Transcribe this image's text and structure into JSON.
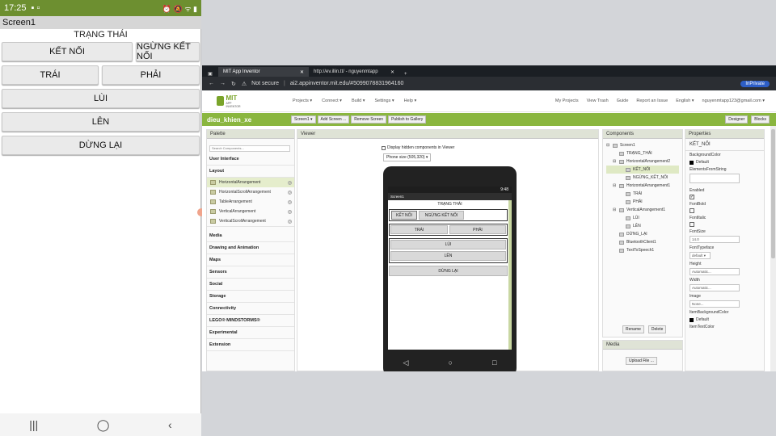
{
  "phone": {
    "status": {
      "time": "17:25",
      "right": "⏰ 🔕 ᯤ ▮"
    },
    "title": "Screen1",
    "label": "TRẠNG THÁI",
    "buttons": {
      "connect": "KẾT NỐI",
      "disconnect": "NGỪNG KẾT NỐI",
      "left": "TRÁI",
      "right": "PHẢI",
      "back": "LÙI",
      "forward": "LÊN",
      "stop": "DỪNG LẠI"
    },
    "nav": {
      "recents": "|||",
      "home": "◯",
      "back": "‹"
    }
  },
  "browser": {
    "tabs": [
      {
        "label": "MIT App Inventor",
        "icon": "app-inventor-icon"
      },
      {
        "label": "http://ev.illin.tt/ - nguyenmtapp"
      }
    ],
    "url_prefix": "Not secure",
    "url": "ai2.appinventor.mit.edu/#5099078831964160",
    "private_label": "InPrivate"
  },
  "appinventor": {
    "logo": {
      "mit": "MIT",
      "sub": "APP INVENTOR"
    },
    "menu": [
      "Projects ▾",
      "Connect ▾",
      "Build ▾",
      "Settings ▾",
      "Help ▾"
    ],
    "right_menu": [
      "My Projects",
      "View Trash",
      "Guide",
      "Report an Issue",
      "English ▾",
      "nguyenmtapp123@gmail.com ▾"
    ],
    "project_name": "dieu_khien_xe",
    "project_buttons": [
      "Screen1 ▾",
      "Add Screen ...",
      "Remove Screen",
      "Publish to Gallery"
    ],
    "mode_buttons": [
      "Designer",
      "Blocks"
    ],
    "palette": {
      "title": "Palette",
      "search_placeholder": "Search Components...",
      "categories_top": [
        "User Interface",
        "Layout"
      ],
      "layout_items": [
        "HorizontalArrangement",
        "HorizontalScrollArrangement",
        "TableArrangement",
        "VerticalArrangement",
        "VerticalScrollArrangement"
      ],
      "categories_bottom": [
        "Media",
        "Drawing and Animation",
        "Maps",
        "Sensors",
        "Social",
        "Storage",
        "Connectivity",
        "LEGO® MINDSTORMS®",
        "Experimental",
        "Extension"
      ]
    },
    "viewer": {
      "title": "Viewer",
      "checkbox_label": "Display hidden components in Viewer",
      "size_select": "Phone size (505,320) ▾",
      "device_time": "9:48",
      "screen_title": "Screen1",
      "label": "TRẠNG THÁI",
      "buttons": {
        "connect": "KẾT NỐI",
        "disconnect": "NGỪNG KẾT NỐI",
        "left": "TRÁI",
        "right": "PHẢI",
        "back": "LÙI",
        "forward": "LÊN",
        "stop": "DỪNG LẠI"
      },
      "nav": [
        "◁",
        "○",
        "□"
      ]
    },
    "components": {
      "title": "Components",
      "tree": [
        {
          "name": "Screen1",
          "level": 0
        },
        {
          "name": "TRẠNG_THÁI",
          "level": 1
        },
        {
          "name": "HorizontalArrangement2",
          "level": 1
        },
        {
          "name": "KẾT_NỐI",
          "level": 2
        },
        {
          "name": "NGỪNG_KẾT_NỐI",
          "level": 2
        },
        {
          "name": "HorizontalArrangement1",
          "level": 1
        },
        {
          "name": "TRÁI",
          "level": 2
        },
        {
          "name": "PHẢI",
          "level": 2
        },
        {
          "name": "VerticalArrangement1",
          "level": 1
        },
        {
          "name": "LÙI",
          "level": 2
        },
        {
          "name": "LÊN",
          "level": 2
        },
        {
          "name": "DỪNG_LẠI",
          "level": 1
        },
        {
          "name": "BluetoothClient1",
          "level": 1
        },
        {
          "name": "TextToSpeech1",
          "level": 1
        }
      ],
      "rename": "Rename",
      "delete": "Delete"
    },
    "media": {
      "title": "Media",
      "upload": "Upload File ..."
    },
    "properties": {
      "title": "Properties",
      "component": "KẾT_NỐI",
      "background_color_label": "BackgroundColor",
      "background_color_value": "Default",
      "elements_label": "ElementsFromString",
      "enabled_label": "Enabled",
      "fontbold_label": "FontBold",
      "fontitalic_label": "FontItalic",
      "fontsize_label": "FontSize",
      "fontsize_value": "14.0",
      "typeface_label": "FontTypeface",
      "typeface_value": "default ▾",
      "height_label": "Height",
      "height_value": "Automatic...",
      "width_label": "Width",
      "width_value": "Automatic...",
      "image_label": "Image",
      "image_value": "None...",
      "itembg_label": "ItemBackgroundColor",
      "itembg_value": "Default",
      "itemtext_label": "ItemTextColor"
    }
  }
}
